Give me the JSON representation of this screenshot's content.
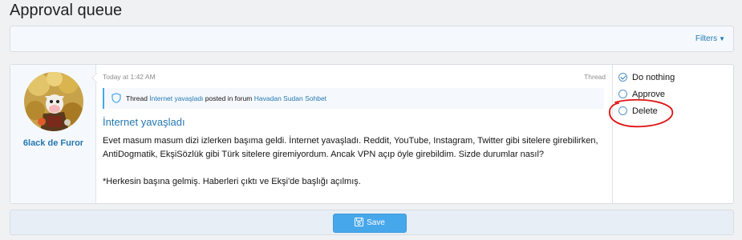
{
  "page": {
    "title": "Approval queue"
  },
  "filter_bar": {
    "filters_label": "Filters",
    "caret_icon": "caret-down-icon"
  },
  "item": {
    "username": "6lack de Furor",
    "timestamp": "Today at 1:42 AM",
    "content_type": "Thread",
    "notice": {
      "prefix": "Thread",
      "thread_link": "İnternet yavaşladı",
      "middle": "posted in forum",
      "forum_link": "Havadan Sudan Sohbet",
      "icon": "shield-icon"
    },
    "title": "İnternet yavaşladı",
    "body": [
      "Evet masum masum dizi izlerken başıma geldi. İnternet yavaşladı. Reddit, YouTube, Instagram, Twitter gibi sitelere girebilirken, AntiDogmatik, EkşiSözlük gibi Türk sitelere giremiyordum. Ancak VPN açıp öyle girebildim. Sizde durumlar nasıl?",
      "*Herkesin başına gelmiş. Haberleri çıktı ve Ekşi'de başlığı açılmış."
    ]
  },
  "actions": {
    "options": [
      {
        "label": "Do nothing",
        "selected": true
      },
      {
        "label": "Approve",
        "selected": false
      },
      {
        "label": "Delete",
        "selected": false
      }
    ]
  },
  "footer": {
    "save_label": "Save",
    "save_icon": "save-icon"
  },
  "colors": {
    "accent": "#2577b1",
    "button": "#47a7eb",
    "annotation": "#e01010"
  }
}
